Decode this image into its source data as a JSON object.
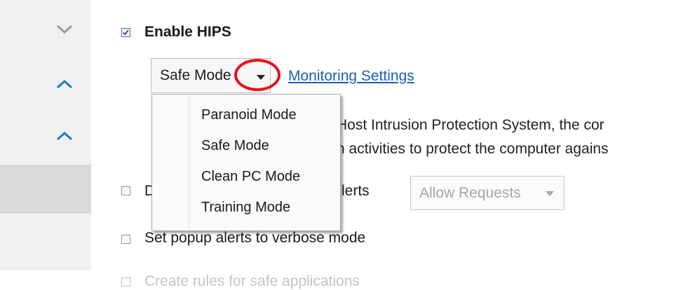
{
  "sidebar": {
    "items": [
      {
        "icon": "chevron-down-icon",
        "color": "#9a9a9a"
      },
      {
        "icon": "chevron-up-icon",
        "color": "#1f78c8"
      },
      {
        "icon": "chevron-up-icon",
        "color": "#1f78c8"
      },
      {
        "icon": "",
        "selected": true
      }
    ]
  },
  "hips": {
    "enable_label": "Enable HIPS",
    "enabled": true,
    "mode_value": "Safe Mode",
    "monitoring_link": "Monitoring Settings"
  },
  "mode_dropdown": {
    "options": [
      "Paranoid Mode",
      "Safe Mode",
      "Clean PC Mode",
      "Training Mode"
    ]
  },
  "description": {
    "line1": "Host Intrusion Protection System, the cor",
    "line2": "n activities to protect the computer agains"
  },
  "alerts": {
    "label_left": "D",
    "label_right": "lerts",
    "select_value": "Allow Requests"
  },
  "verbose": {
    "label": "Set popup alerts to verbose mode"
  },
  "safe_apps": {
    "label": "Create rules for safe applications"
  },
  "colors": {
    "accent": "#1f78c8",
    "link": "#1a5fb4",
    "highlight": "#e8101a"
  }
}
